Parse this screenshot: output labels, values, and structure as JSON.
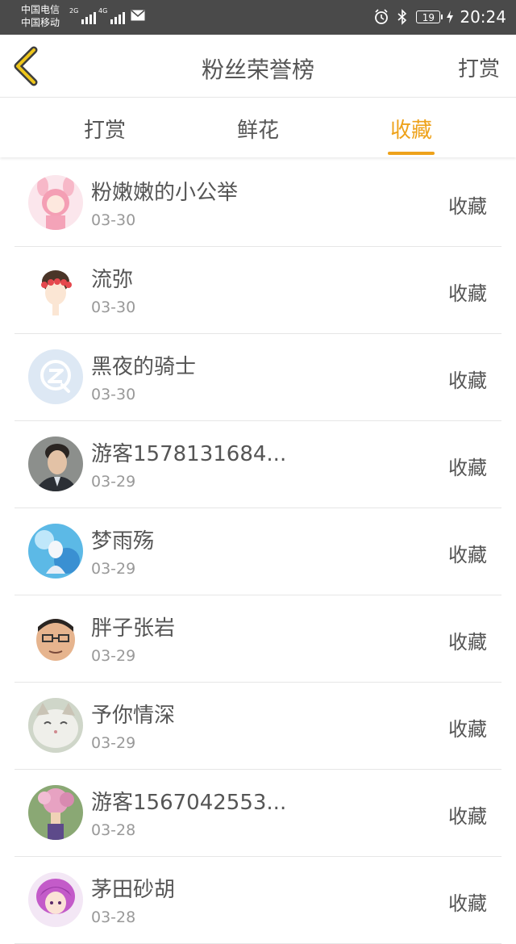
{
  "status_bar": {
    "carrier_1": "中国电信",
    "carrier_2": "中国移动",
    "net_1": "2G",
    "net_2": "4G",
    "battery": "19",
    "time": "20:24"
  },
  "header": {
    "title": "粉丝荣誉榜",
    "action": "打赏"
  },
  "tabs": [
    {
      "label": "打赏"
    },
    {
      "label": "鲜花"
    },
    {
      "label": "收藏",
      "active": true
    }
  ],
  "accent_color": "#eea21b",
  "list": [
    {
      "name": "粉嫩嫩的小公举",
      "date": "03-30",
      "action": "收藏"
    },
    {
      "name": "流弥",
      "date": "03-30",
      "action": "收藏"
    },
    {
      "name": "黑夜的骑士",
      "date": "03-30",
      "action": "收藏"
    },
    {
      "name": "游客1578131684...",
      "date": "03-29",
      "action": "收藏"
    },
    {
      "name": "梦雨殇",
      "date": "03-29",
      "action": "收藏"
    },
    {
      "name": "胖子张岩",
      "date": "03-29",
      "action": "收藏"
    },
    {
      "name": "予你情深",
      "date": "03-29",
      "action": "收藏"
    },
    {
      "name": "游客1567042553...",
      "date": "03-28",
      "action": "收藏"
    },
    {
      "name": "茅田砂胡",
      "date": "03-28",
      "action": "收藏"
    }
  ]
}
